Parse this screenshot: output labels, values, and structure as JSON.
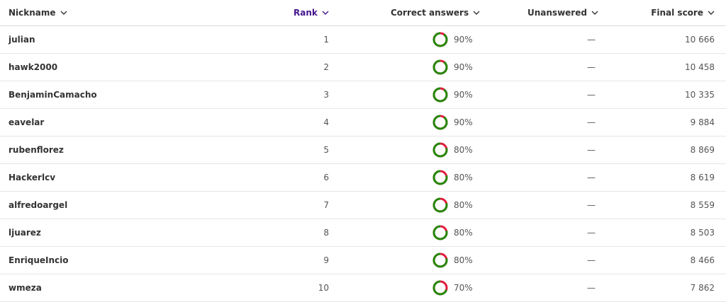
{
  "header": {
    "nickname": "Nickname",
    "rank": "Rank",
    "correct": "Correct answers",
    "unanswered": "Unanswered",
    "final": "Final score"
  },
  "colors": {
    "correct": "#26890c",
    "wrong": "#e21b3c",
    "accent": "#46178f"
  },
  "rows": [
    {
      "nickname": "julian",
      "rank": "1",
      "correct_pct": "90%",
      "correct_fraction": 0.9,
      "unanswered": "—",
      "score": "10 666"
    },
    {
      "nickname": "hawk2000",
      "rank": "2",
      "correct_pct": "90%",
      "correct_fraction": 0.9,
      "unanswered": "—",
      "score": "10 458"
    },
    {
      "nickname": "BenjaminCamacho",
      "rank": "3",
      "correct_pct": "90%",
      "correct_fraction": 0.9,
      "unanswered": "—",
      "score": "10 335"
    },
    {
      "nickname": "eavelar",
      "rank": "4",
      "correct_pct": "90%",
      "correct_fraction": 0.9,
      "unanswered": "—",
      "score": "9 884"
    },
    {
      "nickname": "rubenflorez",
      "rank": "5",
      "correct_pct": "80%",
      "correct_fraction": 0.8,
      "unanswered": "—",
      "score": "8 869"
    },
    {
      "nickname": "Hackerlcv",
      "rank": "6",
      "correct_pct": "80%",
      "correct_fraction": 0.8,
      "unanswered": "—",
      "score": "8 619"
    },
    {
      "nickname": "alfredoargel",
      "rank": "7",
      "correct_pct": "80%",
      "correct_fraction": 0.8,
      "unanswered": "—",
      "score": "8 559"
    },
    {
      "nickname": "ljuarez",
      "rank": "8",
      "correct_pct": "80%",
      "correct_fraction": 0.8,
      "unanswered": "—",
      "score": "8 503"
    },
    {
      "nickname": "EnriqueIncio",
      "rank": "9",
      "correct_pct": "80%",
      "correct_fraction": 0.8,
      "unanswered": "—",
      "score": "8 466"
    },
    {
      "nickname": "wmeza",
      "rank": "10",
      "correct_pct": "70%",
      "correct_fraction": 0.7,
      "unanswered": "—",
      "score": "7 862"
    }
  ]
}
